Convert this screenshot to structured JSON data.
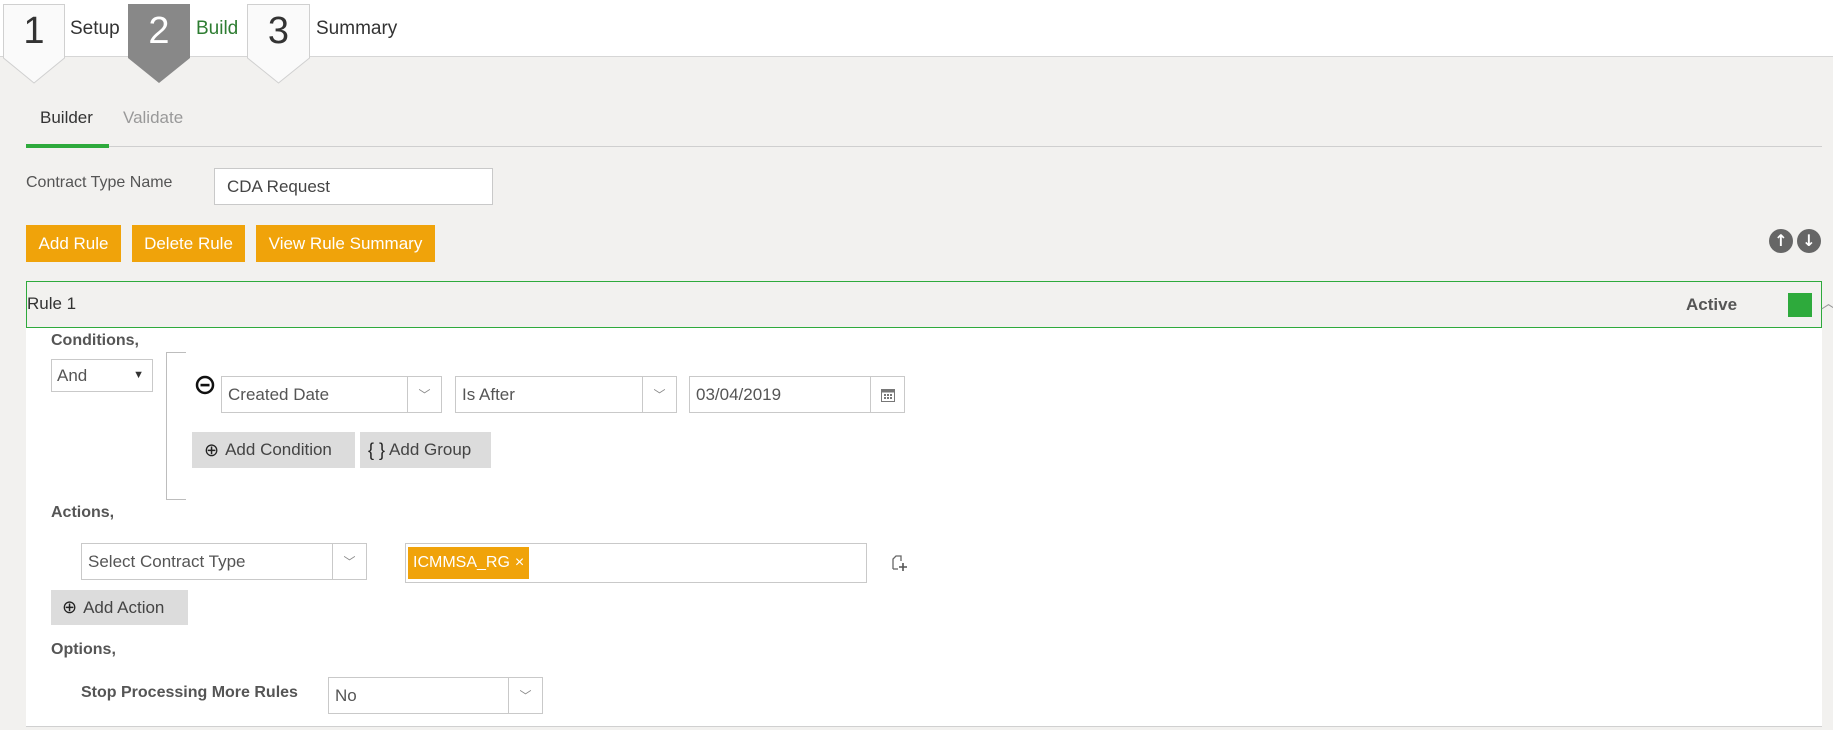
{
  "wizard": {
    "steps": [
      {
        "number": "1",
        "label": "Setup",
        "active": false
      },
      {
        "number": "2",
        "label": "Build",
        "active": true
      },
      {
        "number": "3",
        "label": "Summary",
        "active": false
      }
    ]
  },
  "tabs": [
    {
      "label": "Builder",
      "active": true
    },
    {
      "label": "Validate",
      "active": false
    }
  ],
  "contract_type": {
    "label": "Contract Type Name",
    "value": "CDA Request"
  },
  "toolbar": {
    "add_rule": "Add Rule",
    "delete_rule": "Delete Rule",
    "view_rule_summary": "View Rule Summary",
    "move_up_icon": "arrow-up-circle-icon",
    "move_down_icon": "arrow-down-circle-icon"
  },
  "rule": {
    "title": "Rule 1",
    "status": "Active",
    "status_color": "#2eaa3c",
    "conditions": {
      "label": "Conditions,",
      "operator": "And",
      "items": [
        {
          "field": "Created Date",
          "comparator": "Is After",
          "value": "03/04/2019"
        }
      ],
      "add_condition": "Add Condition",
      "add_group": "Add Group"
    },
    "actions": {
      "label": "Actions,",
      "select_placeholder": "Select Contract Type",
      "tags": [
        {
          "label": "ICMMSA_RG",
          "remove": "×"
        }
      ],
      "add_action": "Add Action"
    },
    "options": {
      "label": "Options,",
      "stop_processing_label": "Stop Processing More Rules",
      "stop_processing_value": "No"
    }
  },
  "colors": {
    "accent_orange": "#f0a30a",
    "accent_green": "#2eaa3c"
  }
}
